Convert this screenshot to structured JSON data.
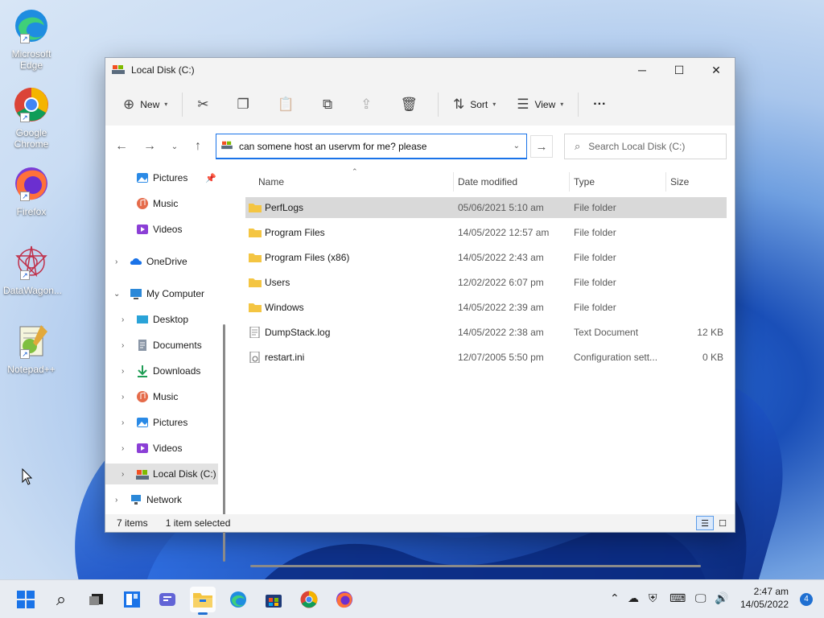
{
  "desktop": {
    "icons": [
      {
        "label": "Microsoft Edge",
        "icon": "edge-icon"
      },
      {
        "label": "Google Chrome",
        "icon": "chrome-icon"
      },
      {
        "label": "Firefox",
        "icon": "firefox-icon"
      },
      {
        "label": "DataWagon...",
        "icon": "datawagon-icon"
      },
      {
        "label": "Notepad++",
        "icon": "notepadpp-icon"
      }
    ]
  },
  "window": {
    "title": "Local Disk (C:)",
    "toolbar": {
      "new_label": "New",
      "sort_label": "Sort",
      "view_label": "View",
      "more_label": "···"
    },
    "nav": {
      "address_value": "can somene host an uservm for me? please",
      "search_placeholder": "Search Local Disk (C:)"
    },
    "sidebar": {
      "items": [
        {
          "label": "Pictures",
          "icon": "pictures-icon",
          "pinned": true
        },
        {
          "label": "Music",
          "icon": "music-icon"
        },
        {
          "label": "Videos",
          "icon": "videos-icon"
        },
        {
          "label": "OneDrive",
          "icon": "onedrive-icon"
        },
        {
          "label": "My Computer",
          "icon": "computer-icon"
        },
        {
          "label": "Desktop",
          "icon": "desktop-icon"
        },
        {
          "label": "Documents",
          "icon": "documents-icon"
        },
        {
          "label": "Downloads",
          "icon": "downloads-icon"
        },
        {
          "label": "Music",
          "icon": "music-icon"
        },
        {
          "label": "Pictures",
          "icon": "pictures-icon"
        },
        {
          "label": "Videos",
          "icon": "videos-icon"
        },
        {
          "label": "Local Disk (C:)",
          "icon": "drive-icon",
          "selected": true
        },
        {
          "label": "Network",
          "icon": "network-icon"
        }
      ]
    },
    "columns": {
      "name": "Name",
      "date": "Date modified",
      "type": "Type",
      "size": "Size"
    },
    "files": [
      {
        "name": "PerfLogs",
        "date": "05/06/2021 5:10 am",
        "type": "File folder",
        "size": "",
        "kind": "folder",
        "selected": true
      },
      {
        "name": "Program Files",
        "date": "14/05/2022 12:57 am",
        "type": "File folder",
        "size": "",
        "kind": "folder"
      },
      {
        "name": "Program Files (x86)",
        "date": "14/05/2022 2:43 am",
        "type": "File folder",
        "size": "",
        "kind": "folder"
      },
      {
        "name": "Users",
        "date": "12/02/2022 6:07 pm",
        "type": "File folder",
        "size": "",
        "kind": "folder"
      },
      {
        "name": "Windows",
        "date": "14/05/2022 2:39 am",
        "type": "File folder",
        "size": "",
        "kind": "folder"
      },
      {
        "name": "DumpStack.log",
        "date": "14/05/2022 2:38 am",
        "type": "Text Document",
        "size": "12 KB",
        "kind": "text"
      },
      {
        "name": "restart.ini",
        "date": "12/07/2005 5:50 pm",
        "type": "Configuration sett...",
        "size": "0 KB",
        "kind": "config"
      }
    ],
    "status": {
      "items": "7 items",
      "selected": "1 item selected"
    }
  },
  "taskbar": {
    "clock_time": "2:47 am",
    "clock_date": "14/05/2022",
    "notification_count": "4"
  },
  "colors": {
    "accent": "#1a73e8",
    "folder": "#f4c542",
    "taskbar_bg": "#e8ecf2"
  }
}
